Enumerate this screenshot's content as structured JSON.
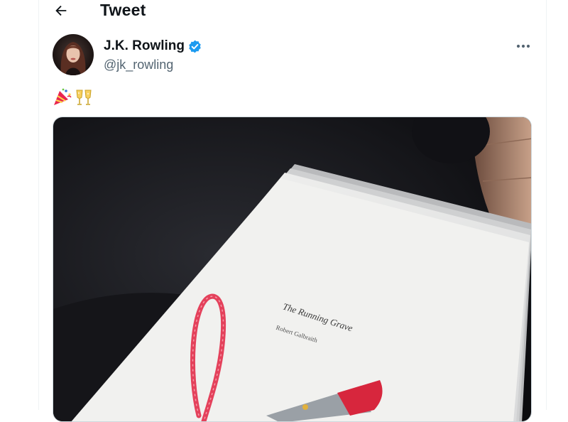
{
  "header": {
    "title": "Tweet"
  },
  "tweet": {
    "author": {
      "display_name": "J.K. Rowling",
      "handle": "@jk_rowling",
      "verified": true
    },
    "text_emojis": [
      "party-popper-icon",
      "clinking-glasses-icon"
    ],
    "media": {
      "manuscript_title": "The Running Grave",
      "manuscript_author": "Robert Galbraith"
    }
  },
  "colors": {
    "verified_badge": "#1d9bf0",
    "handle_gray": "#536471",
    "text": "#0f1419",
    "border": "#eff3f4",
    "usb_red": "#d7263d"
  }
}
